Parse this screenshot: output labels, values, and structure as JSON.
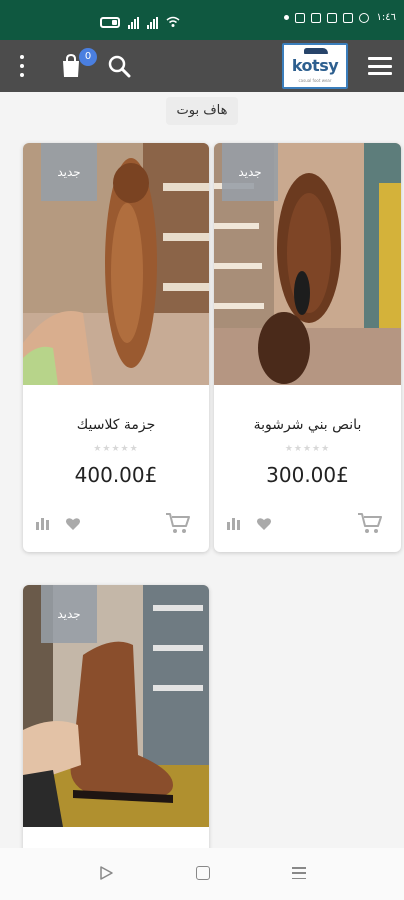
{
  "status_bar": {
    "time": "١:٤٦"
  },
  "header": {
    "cart_count": "0",
    "logo_text": "kotsy",
    "logo_subtext": "casual foot wear"
  },
  "category": {
    "label": "هاف بوت"
  },
  "products": [
    {
      "name": "بانص بني شرشوبة",
      "price": "300.00£",
      "badge": "جديد",
      "rating_stars": "★★★★★"
    },
    {
      "name": "جزمة كلاسيك",
      "price": "400.00£",
      "badge": "جديد",
      "rating_stars": "★★★★★"
    },
    {
      "name": "",
      "price": "",
      "badge": "جديد",
      "rating_stars": ""
    }
  ],
  "colors": {
    "status_bar": "#0f5840",
    "app_bar": "#4c4c4c",
    "badge": "#4a7fe0",
    "new_badge": "#969ea6"
  }
}
